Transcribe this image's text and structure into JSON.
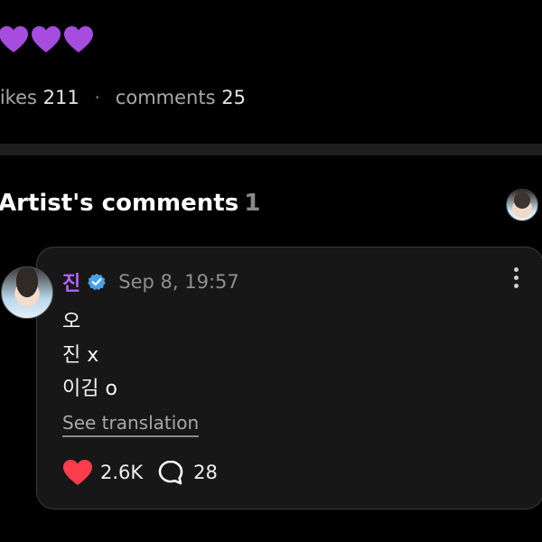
{
  "stats": {
    "likes_label": "likes",
    "likes_count": "211",
    "separator": "·",
    "comments_label": "comments",
    "comments_count": "25"
  },
  "icons": {
    "purple_heart": "purple-heart-icon",
    "verified": "verified-badge-icon",
    "more": "more-vertical-icon",
    "like": "heart-icon",
    "comment": "comment-icon"
  },
  "colors": {
    "purple_heart": "#a64de0",
    "artist_name": "#b265ff",
    "verified_badge": "#4aa0e8",
    "like_heart": "#ff3b4e"
  },
  "section": {
    "title": "Artist's comments",
    "count": "1"
  },
  "comment": {
    "author": "진",
    "date": "Sep 8, 19:57",
    "lines": [
      "오",
      "진 x",
      "이김 o"
    ],
    "translate_label": "See translation",
    "likes": "2.6K",
    "replies": "28"
  }
}
